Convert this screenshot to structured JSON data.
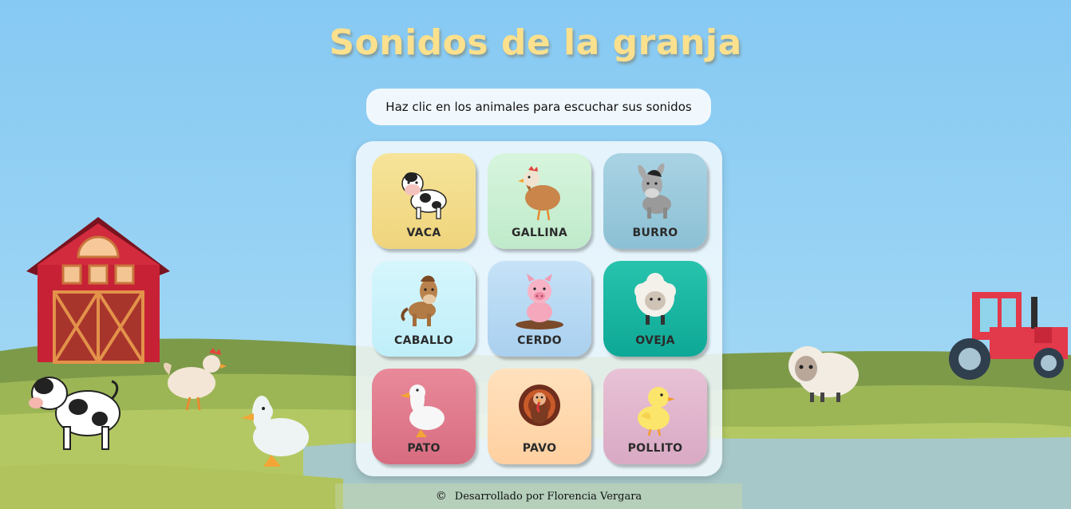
{
  "header": {
    "title": "Sonidos de la granja",
    "subtitle": "Haz clic en los animales para escuchar sus sonidos"
  },
  "animals": [
    {
      "label": "VACA",
      "icon": "cow-icon",
      "bg": "#f3dd87"
    },
    {
      "label": "GALLINA",
      "icon": "hen-icon",
      "bg": "#c9f0d6"
    },
    {
      "label": "BURRO",
      "icon": "donkey-icon",
      "bg": "#9cc9dc"
    },
    {
      "label": "CABALLO",
      "icon": "horse-icon",
      "bg": "#c7f1fb"
    },
    {
      "label": "CERDO",
      "icon": "pig-icon",
      "bg": "#b8daf4"
    },
    {
      "label": "OVEJA",
      "icon": "sheep-icon",
      "bg": "#19b5a2"
    },
    {
      "label": "PATO",
      "icon": "duck-icon",
      "bg": "#e07c8d"
    },
    {
      "label": "PAVO",
      "icon": "turkey-icon",
      "bg": "#ffd9b0"
    },
    {
      "label": "POLLITO",
      "icon": "chick-icon",
      "bg": "#e2b7cf"
    }
  ],
  "footer": {
    "copyright_symbol": "©",
    "credit": "Desarrollado por Florencia Vergara"
  },
  "colors": {
    "sky": "#87cdf5",
    "title": "#fbe08d",
    "grass_dark": "#7e9b4a",
    "grass_light": "#a9c25e",
    "barn": "#c72135",
    "tractor": "#e2394b"
  }
}
